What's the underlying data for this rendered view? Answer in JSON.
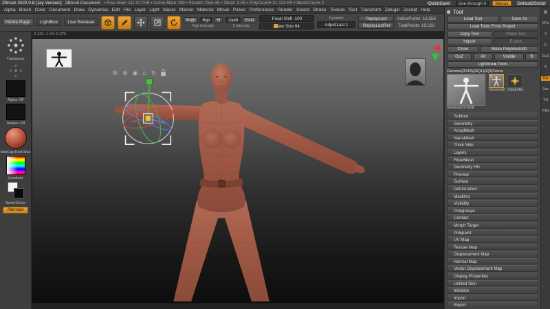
{
  "colors": {
    "accent": "#d98a1f",
    "skin": "#a05846",
    "canvas_top": "#7b7b7b",
    "canvas_bottom": "#0d0d0d"
  },
  "titlebar": {
    "app_title": "ZBrush 2022.0.8 [Jay Versluis]",
    "doc_title": "ZBrush Document",
    "stats": "• Free Mem 111.017GB  • Active Mem 709  • Scratch Disk 49  • Timer: 0.09  • PolyCount• 21.113 KP  • MeshCount• 2",
    "quicksave": "QuickSave",
    "see_through": "See-through 0",
    "menus": "Menus",
    "default_zscript": "DefaultZScript"
  },
  "menubar": {
    "items": [
      "Alpha",
      "Brush",
      "Color",
      "Document",
      "Draw",
      "Dynamics",
      "Edit",
      "File",
      "Layer",
      "Light",
      "Macro",
      "Marker",
      "Material",
      "Movie",
      "Picker",
      "Preferences",
      "Render",
      "Sword",
      "Stroke",
      "Texture",
      "Tool",
      "Transform",
      "Zplugin",
      "Zscript",
      "Help"
    ]
  },
  "toolbar": {
    "home_page": "Home Page",
    "lightbox": "LightBox",
    "live_boolean": "Live Boolean",
    "mrgb": "Mrgb",
    "rgb": "Rgb",
    "m": "M",
    "zadd": "Zadd",
    "zsub": "Zsub",
    "rgb_intensity": "Rgb Intensity",
    "z_intensity": "Z Intensity",
    "focal_shift": "Focal Shift -100",
    "draw_size": "Draw Size 64",
    "dynamic": "Dynamic",
    "adjust_last": "AdjustLast 1",
    "replay_last": "ReplayLast",
    "replay_last_rel": "ReplayLastRel",
    "active_points": "ActivePoints: 16.556",
    "total_points": "TotalPoints: 19.229"
  },
  "left_shelf": {
    "brush_label": "Transpose",
    "alpha_label": "Alpha Off",
    "texture_label": "Texture Off",
    "material_label": "MatCap Red Wax",
    "gradient_label": "Gradient",
    "switch_label": "SwitchColor",
    "alternate_label": "Alternate"
  },
  "canvas": {
    "coords": "0.133.-1.04.-0.075",
    "icons": [
      {
        "name": "gear-icon",
        "glyph": "⚙"
      },
      {
        "name": "transpose-icon",
        "glyph": "⊕"
      },
      {
        "name": "pivot-icon",
        "glyph": "◉"
      },
      {
        "name": "home-icon",
        "glyph": "⌂"
      },
      {
        "name": "turntable-icon",
        "glyph": "↻"
      }
    ]
  },
  "tool_panel": {
    "title": "Tool",
    "load_tool": "Load Tool",
    "save_as": "Save As",
    "load_from_project": "Load Tools From Project",
    "copy_tool": "Copy Tool",
    "paste_tool": "Paste Tool",
    "import": "Import",
    "export": "Export",
    "clone": "Clone",
    "make_polymesh": "Make PolyMesh3D",
    "goz": "GoZ",
    "all": "All",
    "visible": "Visible",
    "r": "R",
    "lightbox_tools": "Lightbox►Tools",
    "current_tool": "Genesis(2018)(2E)1)(2(0)Fema",
    "big_thumb_label": "Genesis2018(2E",
    "thumb1_label": "Genesis2018(2E",
    "thumb2_label": "SimpleBrush",
    "count_badge": "2",
    "subpalettes": [
      "Subtool",
      "Geometry",
      "ArrayMesh",
      "NanoMesh",
      "Thick Skin",
      "Layers",
      "FiberMesh",
      "Geometry HD",
      "Preview",
      "Surface",
      "Deformation",
      "Masking",
      "Visibility",
      "Polygroups",
      "Contact",
      "Morph Target",
      "Polypaint",
      "UV Map",
      "Texture Map",
      "Displacement Map",
      "Normal Map",
      "Vector Displacement Map",
      "Display Properties",
      "Unified Skin",
      "Initialize",
      "Import",
      "Export"
    ]
  },
  "right_strip": {
    "items": [
      "▦",
      "SPa",
      "3",
      "D",
      "GoZ",
      "A",
      "Giz",
      "Sav",
      "TH",
      "PIN"
    ]
  }
}
